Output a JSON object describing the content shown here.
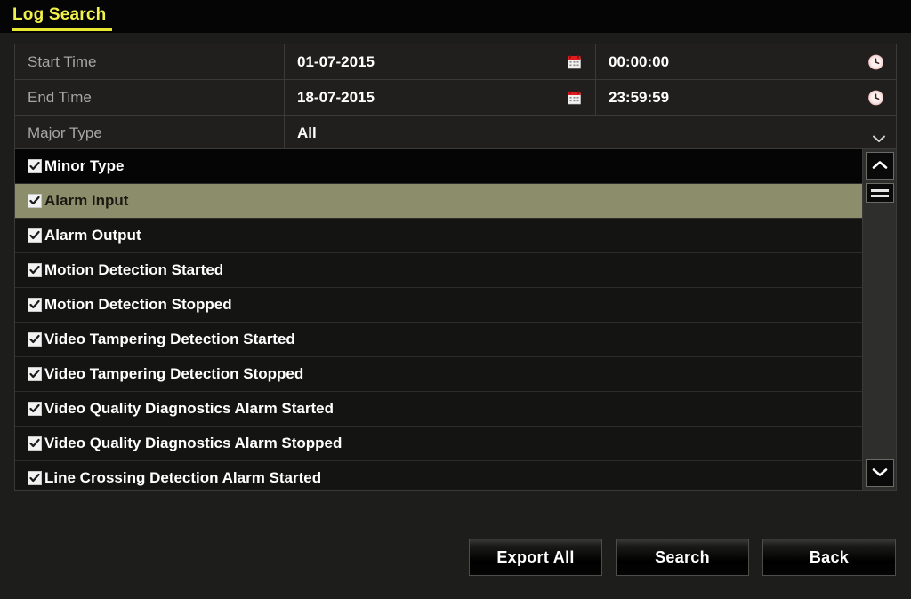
{
  "window": {
    "title": "Log Search",
    "accent_color": "#e8e832",
    "background_color": "#1d1d1b",
    "highlight_color": "#8b8d6b"
  },
  "form": {
    "rows": [
      {
        "label": "Start Time",
        "date_value": "01-07-2015",
        "time_value": "00:00:00",
        "date_icon": "calendar-icon",
        "time_icon": "clock-icon"
      },
      {
        "label": "End Time",
        "date_value": "18-07-2015",
        "time_value": "23:59:59",
        "date_icon": "calendar-icon",
        "time_icon": "clock-icon"
      }
    ],
    "major_type": {
      "label": "Major Type",
      "value": "All",
      "icon": "chevron-down-icon"
    }
  },
  "minor_type_list": {
    "header": {
      "label": "Minor Type",
      "checked": true
    },
    "items": [
      {
        "label": "Alarm Input",
        "checked": true,
        "selected": true
      },
      {
        "label": "Alarm Output",
        "checked": true,
        "selected": false
      },
      {
        "label": "Motion Detection Started",
        "checked": true,
        "selected": false
      },
      {
        "label": "Motion Detection Stopped",
        "checked": true,
        "selected": false
      },
      {
        "label": "Video Tampering Detection Started",
        "checked": true,
        "selected": false
      },
      {
        "label": "Video Tampering Detection Stopped",
        "checked": true,
        "selected": false
      },
      {
        "label": "Video Quality Diagnostics Alarm Started",
        "checked": true,
        "selected": false
      },
      {
        "label": "Video Quality Diagnostics Alarm Stopped",
        "checked": true,
        "selected": false
      },
      {
        "label": "Line Crossing Detection Alarm Started",
        "checked": true,
        "selected": false
      }
    ],
    "scrollbar": {
      "up_icon": "chevron-up-icon",
      "down_icon": "chevron-down-icon",
      "thumb_icon": "scroll-thumb-grip"
    }
  },
  "footer": {
    "export_all_label": "Export All",
    "search_label": "Search",
    "back_label": "Back"
  }
}
